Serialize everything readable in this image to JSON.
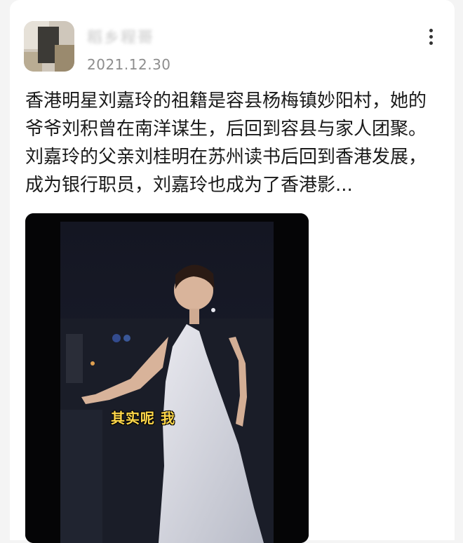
{
  "post": {
    "author": {
      "name": "稻乡程哥",
      "date": "2021.12.30"
    },
    "text": "香港明星刘嘉玲的祖籍是容县杨梅镇妙阳村，她的爷爷刘积曾在南洋谋生，后回到容县与家人团聚。刘嘉玲的父亲刘桂明在苏州读书后回到香港发展，成为银行职员，刘嘉玲也成为了香港影...",
    "media": {
      "subtitle": "其实呢 我"
    },
    "more_icon": "more-vertical-icon"
  },
  "colors": {
    "card": "#ffffff",
    "background": "#f4f4f4",
    "date": "#8d8d8d",
    "subtitle": "#ffd84a"
  }
}
